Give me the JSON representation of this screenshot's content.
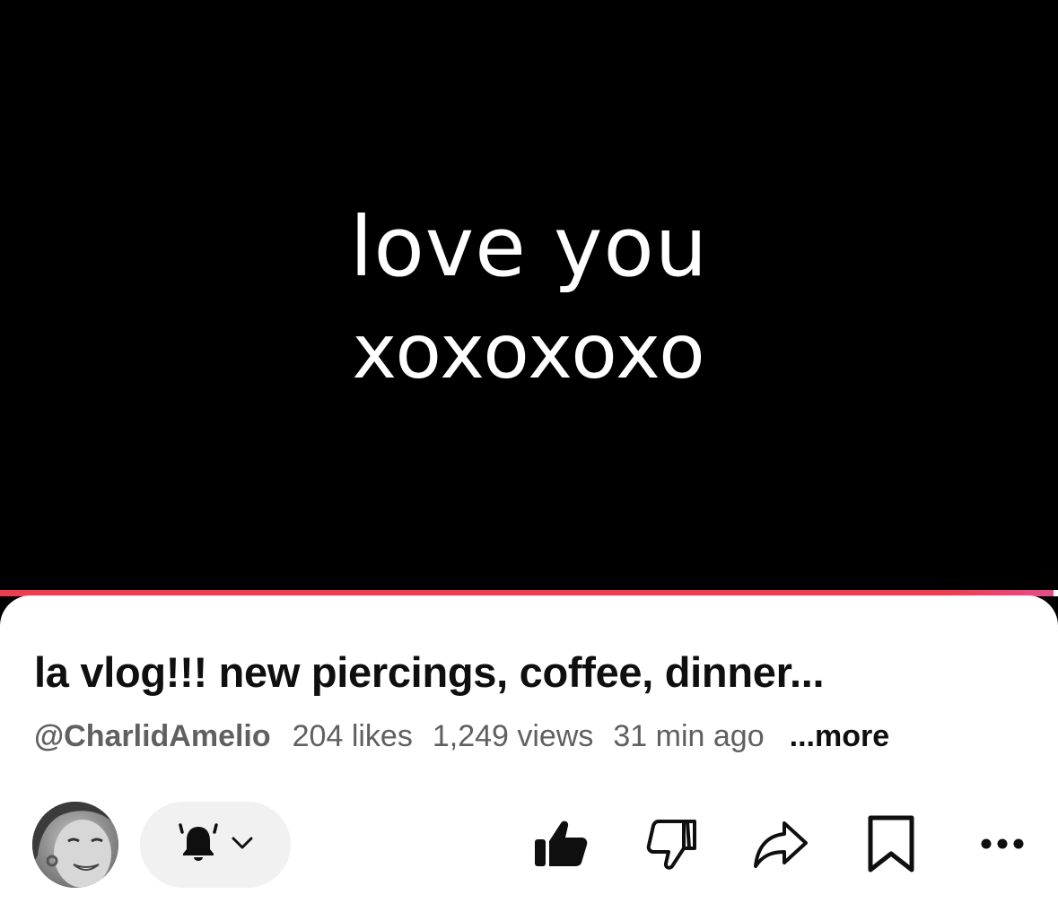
{
  "video": {
    "caption_line1": "love you",
    "caption_line2": "xoxoxoxo",
    "progress_fraction": 0.996
  },
  "details": {
    "title": "la vlog!!! new piercings, coffee, dinner...",
    "channel_handle": "@CharlidAmelio",
    "likes": "204 likes",
    "views": "1,249 views",
    "time_ago": "31 min ago",
    "more_label": "...more"
  },
  "actions": {
    "icons": [
      "avatar",
      "bell-icon",
      "chevron-down-icon",
      "thumbs-up-icon",
      "thumbs-down-icon",
      "share-icon",
      "bookmark-icon",
      "more-icon"
    ],
    "like_active": true
  },
  "colors": {
    "progress": "#e83f51",
    "text_primary": "#0f0f0f",
    "text_secondary": "#606060",
    "pill_bg": "#f1f1f1"
  }
}
